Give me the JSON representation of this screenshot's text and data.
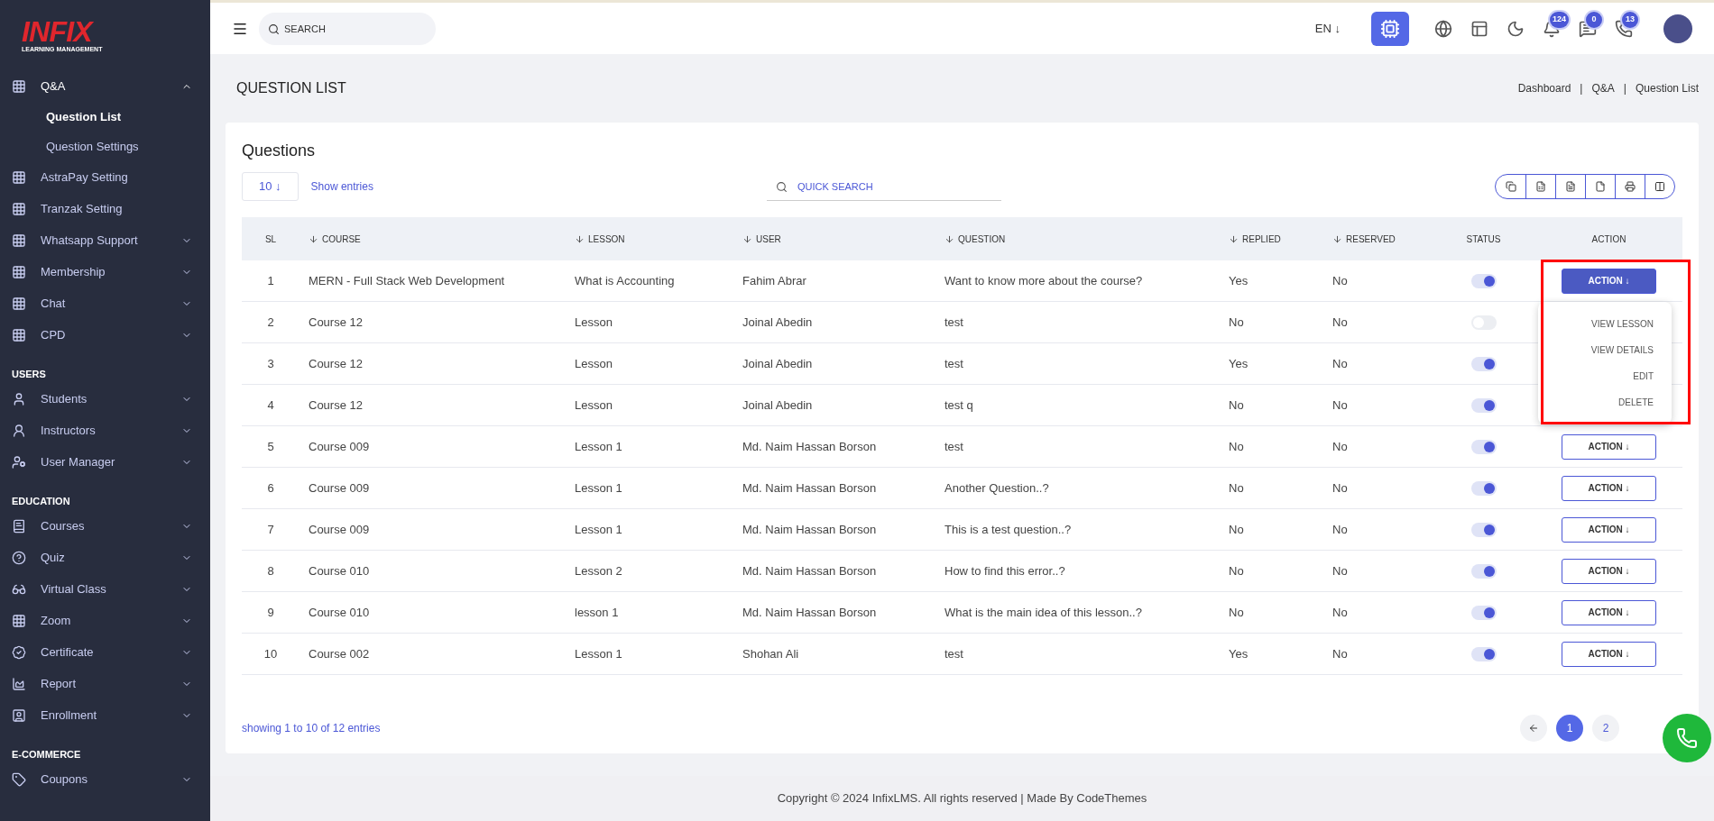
{
  "sidebar": {
    "logo": {
      "title": "INFIX",
      "subtitle": "LEARNING MANAGEMENT"
    },
    "sections": [
      {
        "items": [
          {
            "label": "Q&A",
            "expandable": true,
            "expanded": true,
            "children": [
              {
                "label": "Question List",
                "selected": true
              },
              {
                "label": "Question Settings",
                "selected": false
              }
            ]
          },
          {
            "label": "AstraPay Setting",
            "expandable": false,
            "expanded": false
          },
          {
            "label": "Tranzak Setting",
            "expandable": false,
            "expanded": false
          },
          {
            "label": "Whatsapp Support",
            "expandable": true,
            "expanded": false
          },
          {
            "label": "Membership",
            "expandable": true,
            "expanded": false
          },
          {
            "label": "Chat",
            "expandable": true,
            "expanded": false
          },
          {
            "label": "CPD",
            "expandable": true,
            "expanded": false
          }
        ]
      },
      {
        "heading": "USERS",
        "items": [
          {
            "label": "Students",
            "expandable": true,
            "expanded": false
          },
          {
            "label": "Instructors",
            "expandable": true,
            "expanded": false
          },
          {
            "label": "User Manager",
            "expandable": true,
            "expanded": false
          }
        ]
      },
      {
        "heading": "EDUCATION",
        "items": [
          {
            "label": "Courses",
            "expandable": true,
            "expanded": false
          },
          {
            "label": "Quiz",
            "expandable": true,
            "expanded": false
          },
          {
            "label": "Virtual Class",
            "expandable": true,
            "expanded": false
          },
          {
            "label": "Zoom",
            "expandable": true,
            "expanded": false
          },
          {
            "label": "Certificate",
            "expandable": true,
            "expanded": false
          },
          {
            "label": "Report",
            "expandable": true,
            "expanded": false
          },
          {
            "label": "Enrollment",
            "expandable": true,
            "expanded": false
          }
        ]
      },
      {
        "heading": "E-COMMERCE",
        "items": [
          {
            "label": "Coupons",
            "expandable": true,
            "expanded": false
          }
        ]
      }
    ]
  },
  "topbar": {
    "search": {
      "placeholder": "SEARCH"
    },
    "language": "EN ↓",
    "badges": {
      "notifications": "124",
      "messages": "0",
      "whatsapp": "13"
    }
  },
  "page": {
    "title": "QUESTION LIST",
    "breadcrumbs": {
      "links": [
        "Dashboard",
        "Q&A",
        "Question List"
      ],
      "separators": [
        "|",
        "|"
      ]
    }
  },
  "card": {
    "title": "Questions",
    "page_size": "10 ↓",
    "page_size_label": "Show entries",
    "quick_search": {
      "placeholder": "QUICK SEARCH"
    },
    "table": {
      "columns": [
        {
          "label": "SL",
          "sortable": false
        },
        {
          "label": "COURSE",
          "sortable": true
        },
        {
          "label": "LESSON",
          "sortable": true
        },
        {
          "label": "USER",
          "sortable": true
        },
        {
          "label": "QUESTION",
          "sortable": true
        },
        {
          "label": "REPLIED",
          "sortable": true
        },
        {
          "label": "RESERVED",
          "sortable": true
        },
        {
          "label": "STATUS",
          "sortable": false
        },
        {
          "label": "ACTION",
          "sortable": false
        }
      ],
      "action_menu": [
        "VIEW LESSON",
        "VIEW DETAILS",
        "EDIT",
        "DELETE"
      ],
      "rows": [
        {
          "sl": "1",
          "course": "MERN - Full Stack Web Development",
          "lesson": "What is Accounting",
          "user": "Fahim Abrar",
          "question": "Want to know more about the course?",
          "replied": "Yes",
          "reserved": "No",
          "status_on": true,
          "action": "ACTION ↓",
          "menu_open": true,
          "highlighted": true
        },
        {
          "sl": "2",
          "course": "Course 12",
          "lesson": "Lesson",
          "user": "Joinal Abedin",
          "question": "test",
          "replied": "No",
          "reserved": "No",
          "status_on": false
        },
        {
          "sl": "3",
          "course": "Course 12",
          "lesson": "Lesson",
          "user": "Joinal Abedin",
          "question": "test",
          "replied": "Yes",
          "reserved": "No",
          "status_on": true
        },
        {
          "sl": "4",
          "course": "Course 12",
          "lesson": "Lesson",
          "user": "Joinal Abedin",
          "question": "test q",
          "replied": "No",
          "reserved": "No",
          "status_on": true
        },
        {
          "sl": "5",
          "course": "Course 009",
          "lesson": "Lesson 1",
          "user": "Md. Naim Hassan Borson",
          "question": "test",
          "replied": "No",
          "reserved": "No",
          "status_on": true,
          "action": "ACTION ↓",
          "menu_open": false
        },
        {
          "sl": "6",
          "course": "Course 009",
          "lesson": "Lesson 1",
          "user": "Md. Naim Hassan Borson",
          "question": "Another Question..?",
          "replied": "No",
          "reserved": "No",
          "status_on": true,
          "action": "ACTION ↓",
          "menu_open": false
        },
        {
          "sl": "7",
          "course": "Course 009",
          "lesson": "Lesson 1",
          "user": "Md. Naim Hassan Borson",
          "question": "This is a test question..?",
          "replied": "No",
          "reserved": "No",
          "status_on": true,
          "action": "ACTION ↓",
          "menu_open": false
        },
        {
          "sl": "8",
          "course": "Course 010",
          "lesson": "Lesson 2",
          "user": "Md. Naim Hassan Borson",
          "question": "How to find this error..?",
          "replied": "No",
          "reserved": "No",
          "status_on": true,
          "action": "ACTION ↓",
          "menu_open": false
        },
        {
          "sl": "9",
          "course": "Course 010",
          "lesson": "lesson 1",
          "user": "Md. Naim Hassan Borson",
          "question": "What is the main idea of this lesson..?",
          "replied": "No",
          "reserved": "No",
          "status_on": true,
          "action": "ACTION ↓",
          "menu_open": false
        },
        {
          "sl": "10",
          "course": "Course 002",
          "lesson": "Lesson 1",
          "user": "Shohan Ali",
          "question": "test",
          "replied": "Yes",
          "reserved": "No",
          "status_on": true,
          "action": "ACTION ↓",
          "menu_open": false
        }
      ]
    },
    "summary": "showing 1 to 10 of 12 entries",
    "pages": [
      {
        "label": "1",
        "selected": true
      },
      {
        "label": "2",
        "selected": false
      }
    ]
  },
  "footer": "Copyright © 2024 InfixLMS. All rights reserved | Made By CodeThemes"
}
